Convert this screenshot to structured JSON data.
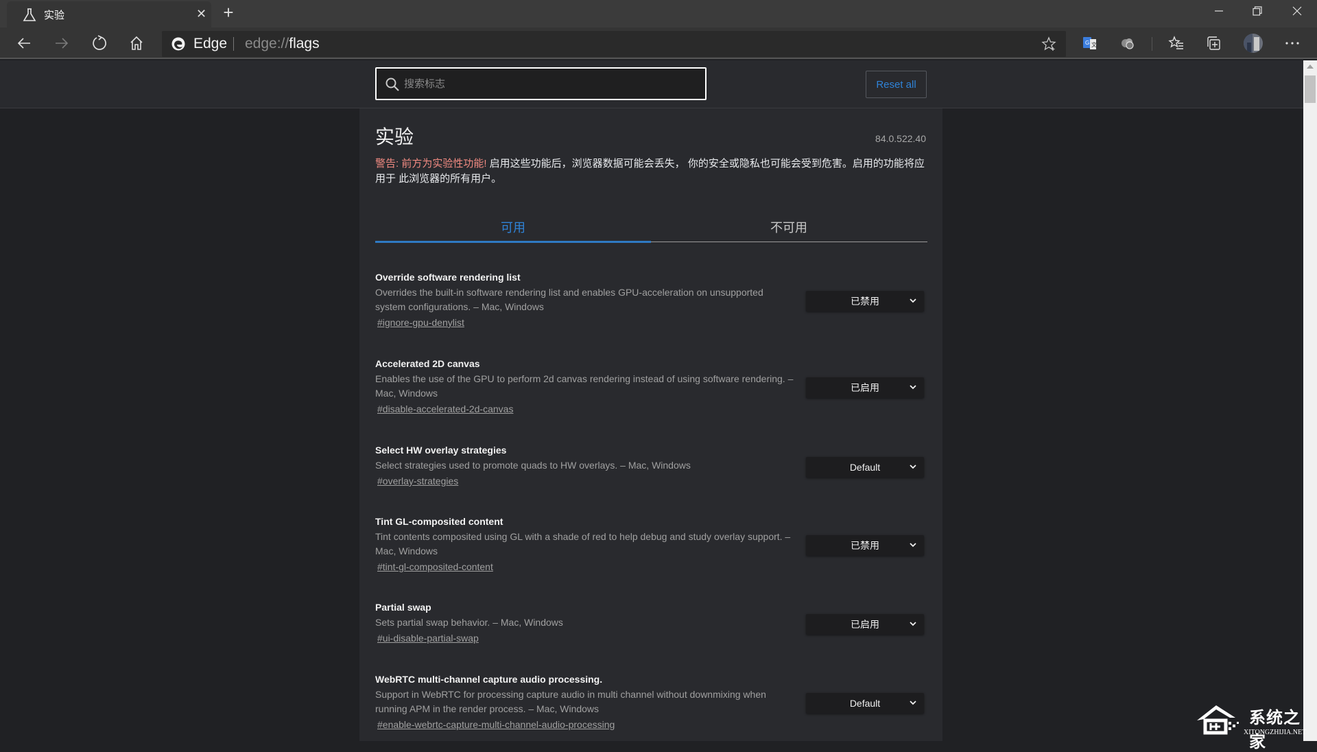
{
  "browser": {
    "tab": {
      "title": "实验",
      "icon": "flask-icon"
    },
    "new_tab_label": "+",
    "window_controls": [
      "minimize",
      "restore",
      "close"
    ],
    "omnibox": {
      "site_label": "Edge",
      "url_scheme": "edge://",
      "url_path": "flags"
    },
    "toolbar_icons": [
      "back-icon",
      "forward-icon",
      "refresh-icon",
      "home-icon",
      "favorite-star-icon",
      "translate-icon",
      "extension-icon",
      "favorites-list-icon",
      "collections-icon",
      "profile-avatar",
      "more-icon"
    ]
  },
  "header": {
    "search_placeholder": "搜索标志",
    "search_value": "",
    "reset_label": "Reset all"
  },
  "main": {
    "title": "实验",
    "version": "84.0.522.40",
    "warning_red": "警告: 前方为实验性功能!",
    "warning_text": " 启用这些功能后，浏览器数据可能会丢失， 你的安全或隐私也可能会受到危害。启用的功能将应用于 此浏览器的所有用户。",
    "tabs": [
      {
        "label": "可用",
        "active": true
      },
      {
        "label": "不可用",
        "active": false
      }
    ],
    "flags": [
      {
        "title": "Override software rendering list",
        "description": "Overrides the built-in software rendering list and enables GPU-acceleration on unsupported system configurations. – Mac, Windows",
        "link": "#ignore-gpu-denylist",
        "value": "已禁用"
      },
      {
        "title": "Accelerated 2D canvas",
        "description": "Enables the use of the GPU to perform 2d canvas rendering instead of using software rendering. – Mac, Windows",
        "link": "#disable-accelerated-2d-canvas",
        "value": "已启用"
      },
      {
        "title": "Select HW overlay strategies",
        "description": "Select strategies used to promote quads to HW overlays. – Mac, Windows",
        "link": "#overlay-strategies",
        "value": "Default"
      },
      {
        "title": "Tint GL-composited content",
        "description": "Tint contents composited using GL with a shade of red to help debug and study overlay support. – Mac, Windows",
        "link": "#tint-gl-composited-content",
        "value": "已禁用"
      },
      {
        "title": "Partial swap",
        "description": "Sets partial swap behavior. – Mac, Windows",
        "link": "#ui-disable-partial-swap",
        "value": "已启用"
      },
      {
        "title": "WebRTC multi-channel capture audio processing.",
        "description": "Support in WebRTC for processing capture audio in multi channel without downmixing when running APM in the render process. – Mac, Windows",
        "link": "#enable-webrtc-capture-multi-channel-audio-processing",
        "value": "Default"
      }
    ]
  },
  "watermark": {
    "cn": "系统之家",
    "en": "XITONGZHIJIA.NET"
  },
  "colors": {
    "accent": "#2f83d8",
    "warning": "#f28b82",
    "background": "#202124",
    "panel": "#292a2e"
  }
}
